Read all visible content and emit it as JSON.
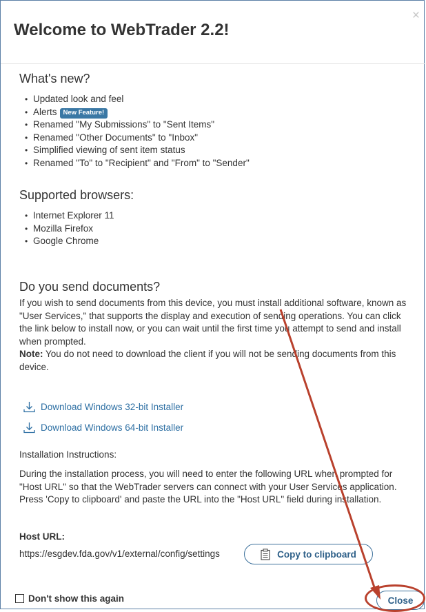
{
  "dialog": {
    "title": "Welcome to WebTrader 2.2!",
    "close_glyph": "×"
  },
  "whats_new": {
    "heading": "What's new?",
    "items": [
      "Updated look and feel",
      "Alerts",
      "Renamed \"My Submissions\" to \"Sent Items\"",
      "Renamed \"Other Documents\" to \"Inbox\"",
      "Simplified viewing of sent item status",
      "Renamed \"To\" to \"Recipient\" and \"From\" to \"Sender\""
    ],
    "badge": "New Feature!"
  },
  "browsers": {
    "heading": "Supported browsers:",
    "items": [
      "Internet Explorer 11",
      "Mozilla Firefox",
      "Google Chrome"
    ]
  },
  "send_docs": {
    "heading": "Do you send documents?",
    "paragraph": "If you wish to send documents from this device, you must install additional software, known as \"User Services,\" that supports the display and execution of sending operations. You can click the link below to install now, or you can wait until the first time you attempt to send and install when prompted.",
    "note_label": "Note:",
    "note_text": " You do not need to download the client if you will not be sending documents from this device."
  },
  "downloads": {
    "link_32": "Download Windows 32-bit Installer",
    "link_64": "Download Windows 64-bit Installer"
  },
  "install": {
    "heading": "Installation Instructions:",
    "paragraph": "During the installation process, you will need to enter the following URL when prompted for \"Host URL\" so that the WebTrader servers can connect with your User Services application. Press 'Copy to clipboard' and paste the URL into the \"Host URL\" field during installation.",
    "host_label": "Host URL:",
    "host_value": "https://esgdev.fda.gov/v1/external/config/settings",
    "copy_label": "Copy to clipboard"
  },
  "footer": {
    "dont_show_label": "Don't show this again",
    "dont_show_checked": false,
    "close_label": "Close"
  },
  "colors": {
    "link": "#2d6fa3",
    "badge": "#3a78a5",
    "annotation": "#b9412d",
    "border": "#5b7fa6"
  },
  "icons": {
    "download": "download-icon",
    "clipboard": "clipboard-icon",
    "close": "close-icon"
  }
}
